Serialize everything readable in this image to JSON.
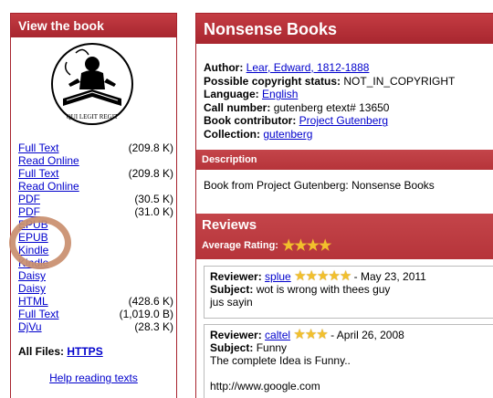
{
  "left_panel": {
    "title": "View the book",
    "files": [
      {
        "label": "Full Text",
        "size": "(209.8 K)"
      },
      {
        "label": "Read Online",
        "size": ""
      },
      {
        "label": "Full Text",
        "size": "(209.8 K)"
      },
      {
        "label": "Read Online",
        "size": ""
      },
      {
        "label": "PDF",
        "size": "(30.5 K)"
      },
      {
        "label": "PDF",
        "size": "(31.0 K)"
      },
      {
        "label": "EPUB",
        "size": ""
      },
      {
        "label": "EPUB",
        "size": ""
      },
      {
        "label": "Kindle",
        "size": ""
      },
      {
        "label": "Kindle",
        "size": ""
      },
      {
        "label": "Daisy",
        "size": ""
      },
      {
        "label": "Daisy",
        "size": ""
      },
      {
        "label": "HTML",
        "size": "(428.6 K)"
      },
      {
        "label": "Full Text",
        "size": "(1,019.0 B)"
      },
      {
        "label": "DjVu",
        "size": "(28.3 K)"
      }
    ],
    "all_files_label": "All Files:",
    "all_files_link": "HTTPS",
    "help_link": "Help reading texts",
    "logo_motto": "QUI LEGIT REGIT"
  },
  "right_panel": {
    "title": "Nonsense Books",
    "metadata": {
      "author_label": "Author:",
      "author_value": "Lear, Edward, 1812-1888",
      "copyright_label": "Possible copyright status:",
      "copyright_value": "NOT_IN_COPYRIGHT",
      "language_label": "Language:",
      "language_value": "English",
      "call_label": "Call number:",
      "call_value": "gutenberg etext# 13650",
      "contributor_label": "Book contributor:",
      "contributor_value": "Project Gutenberg",
      "collection_label": "Collection:",
      "collection_value": "gutenberg"
    },
    "description_header": "Description",
    "description_text": "Book from Project Gutenberg: Nonsense Books",
    "reviews_header": "Reviews",
    "average_rating_label": "Average Rating:",
    "average_rating": 4,
    "reviews": [
      {
        "reviewer_label": "Reviewer:",
        "reviewer": "splue",
        "stars": 5,
        "date": "- May 23, 2011",
        "subject_label": "Subject:",
        "subject": "wot is wrong with thees guy",
        "body": "jus sayin"
      },
      {
        "reviewer_label": "Reviewer:",
        "reviewer": "caltel",
        "stars": 3,
        "date": "- April 26, 2008",
        "subject_label": "Subject:",
        "subject": "Funny",
        "body": "The complete Idea is Funny..",
        "body2": "http://www.google.com"
      }
    ]
  },
  "colors": {
    "header_red": "#a8262f",
    "link_blue": "#0000cc",
    "star_gold": "#f2c02c",
    "highlight_circle": "#c98e6e"
  }
}
